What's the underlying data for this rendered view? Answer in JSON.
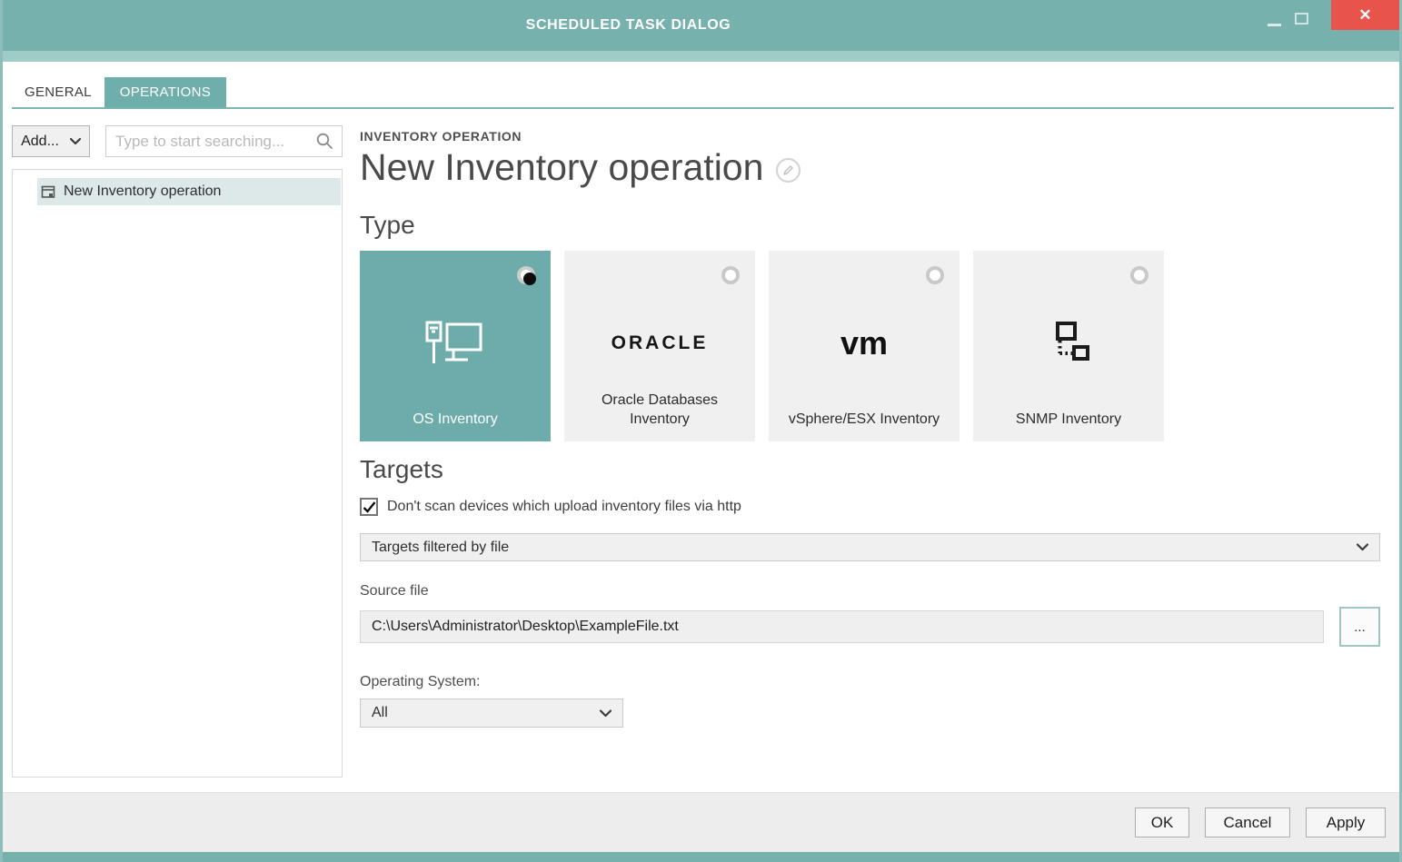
{
  "window": {
    "title": "SCHEDULED TASK DIALOG",
    "close_glyph": "✕"
  },
  "tabs": [
    {
      "label": "GENERAL",
      "active": false
    },
    {
      "label": "OPERATIONS",
      "active": true
    }
  ],
  "sidebar": {
    "add_button_label": "Add...",
    "search_placeholder": "Type to start searching...",
    "items": [
      {
        "label": "New Inventory operation",
        "selected": true
      }
    ]
  },
  "main": {
    "eyebrow": "INVENTORY OPERATION",
    "title": "New Inventory operation",
    "type_section": {
      "heading": "Type",
      "tiles": [
        {
          "label": "OS Inventory",
          "icon": "os-inventory-icon",
          "selected": true
        },
        {
          "label": "Oracle Databases Inventory",
          "logo_text": "ORACLE",
          "icon": "oracle-logo",
          "selected": false
        },
        {
          "label": "vSphere/ESX Inventory",
          "logo_text": "vm",
          "icon": "vmware-logo",
          "selected": false
        },
        {
          "label": "SNMP Inventory",
          "icon": "snmp-icon",
          "selected": false
        }
      ]
    },
    "targets_section": {
      "heading": "Targets",
      "checkbox": {
        "label": "Don't scan devices which upload inventory files via http",
        "checked": true
      },
      "filter_select": {
        "value": "Targets filtered by file"
      },
      "source_file": {
        "label": "Source file",
        "value": "C:\\Users\\Administrator\\Desktop\\ExampleFile.txt",
        "browse_label": "..."
      },
      "os_select": {
        "label": "Operating System:",
        "value": "All"
      }
    }
  },
  "footer": {
    "buttons": [
      {
        "label": "OK"
      },
      {
        "label": "Cancel"
      },
      {
        "label": "Apply"
      }
    ]
  },
  "colors": {
    "titlebar_teal": "#76b1ae",
    "strip_teal": "#a0ccc8",
    "tile_teal": "#6dacaa",
    "close_red": "#e8544b",
    "selected_row": "#dce9e8"
  }
}
